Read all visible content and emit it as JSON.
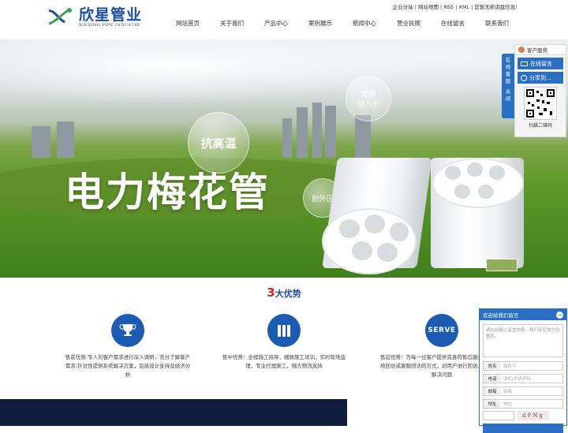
{
  "header": {
    "logo_cn": "欣星管业",
    "logo_en": "XINXING PIPE INDUSTRY",
    "toplinks": "企业分站 | 网站地图 | RSS | XML | 您暂无新询盘信息!",
    "nav": [
      "网站首页",
      "关于我们",
      "产品中心",
      "案例展示",
      "新闻中心",
      "营业执照",
      "在线留言",
      "联系我们"
    ]
  },
  "banner": {
    "headline": "电力梅花管",
    "bubbles": [
      "抗高温",
      "摩擦\n阻力小",
      "耐外压"
    ]
  },
  "advantages": {
    "title_num": "3",
    "title_text": "大优势",
    "items": [
      {
        "icon": "trophy-icon",
        "text": "售前优势:专人对客户需求进行深入调研，充分了解客户需求;针对性提供系统解决方案，包括设计支持及经济分析"
      },
      {
        "icon": "books-icon",
        "text": "售中优势：全程施工指导，细致施工培训，实时现场监理，专业代理施工，强大物流支持"
      },
      {
        "icon": "serve-icon",
        "icon_label": "SERVE",
        "text": "售后优势：为每一位客户提供完善的售后服务，通过工地回访或客服回访的方式，对用户进行回访，帮助客户解决问题"
      }
    ]
  },
  "float_service": {
    "tab_label": "在线客服",
    "tab_close": "关闭",
    "head": "客户服务",
    "buttons": [
      "在线留言",
      "分享到..."
    ],
    "qr_caption": "扫描二维码"
  },
  "message_box": {
    "title": "欢迎给我们留言",
    "close": "−",
    "placeholder": "请在此输入留言内容，我们会尽快与您联系。",
    "fields": [
      {
        "label": "姓名",
        "placeholder": "联系人"
      },
      {
        "label": "电话",
        "placeholder": "座机/手机号码"
      },
      {
        "label": "邮箱",
        "placeholder": "邮箱"
      },
      {
        "label": "地址",
        "placeholder": "地址"
      }
    ],
    "captcha": "dPNg"
  },
  "colors": {
    "brand_blue": "#1c4fa3",
    "accent_red": "#e02020",
    "float_blue": "#2a6fc4",
    "footer_navy": "#0f1e3d"
  }
}
